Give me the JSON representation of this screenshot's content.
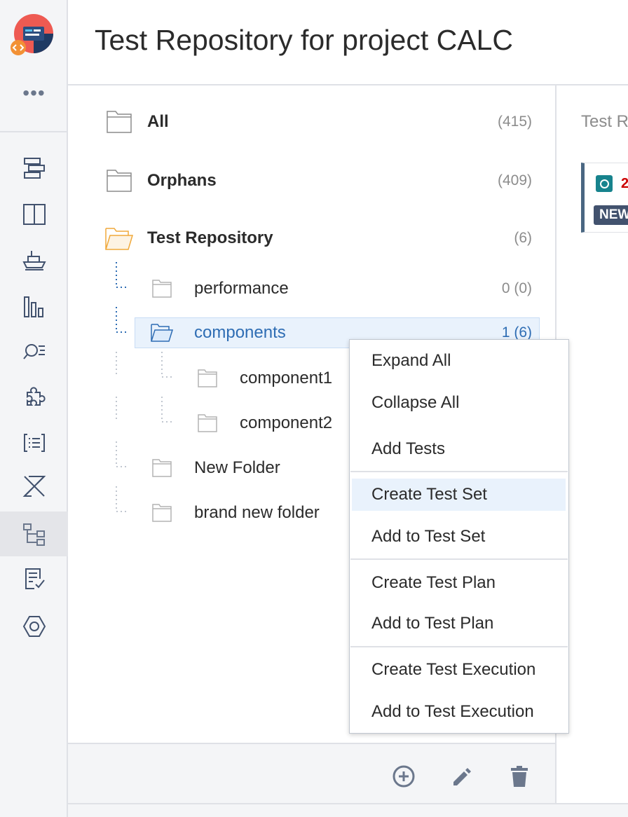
{
  "header": {
    "title": "Test Repository for project CALC"
  },
  "rail": {
    "more_label": "•••",
    "items": [
      {
        "name": "backlog-icon"
      },
      {
        "name": "board-icon"
      },
      {
        "name": "releases-icon"
      },
      {
        "name": "reports-icon"
      },
      {
        "name": "issues-search-icon"
      },
      {
        "name": "add-ons-icon"
      },
      {
        "name": "components-icon"
      },
      {
        "name": "xray-icon"
      },
      {
        "name": "test-repository-icon",
        "active": true
      },
      {
        "name": "test-plan-board-icon"
      },
      {
        "name": "settings-icon"
      }
    ]
  },
  "tree": {
    "all": {
      "label": "All",
      "count": "(415)"
    },
    "orphans": {
      "label": "Orphans",
      "count": "(409)"
    },
    "repository": {
      "label": "Test Repository",
      "count": "(6)"
    },
    "performance": {
      "label": "performance",
      "count": "0 (0)"
    },
    "components": {
      "label": "components",
      "count": "1 (6)"
    },
    "component1": {
      "label": "component1"
    },
    "component2": {
      "label": "component2"
    },
    "new_folder": {
      "label": "New Folder"
    },
    "brand_new_folder": {
      "label": "brand new folder"
    }
  },
  "right_panel": {
    "section_title": "Test R",
    "card": {
      "issue_key": "2",
      "status": "NEW"
    }
  },
  "context_menu": {
    "expand_all": "Expand All",
    "collapse_all": "Collapse All",
    "add_tests": "Add Tests",
    "create_test_set": "Create Test Set",
    "add_to_test_set": "Add to Test Set",
    "create_test_plan": "Create Test Plan",
    "add_to_test_plan": "Add to Test Plan",
    "create_test_execution": "Create Test Execution",
    "add_to_test_execution": "Add to Test Execution"
  },
  "colors": {
    "accent": "#2e6db4",
    "folder_open": "#f0a93b",
    "status_badge": "#42526e",
    "test_type": "#17838d"
  }
}
